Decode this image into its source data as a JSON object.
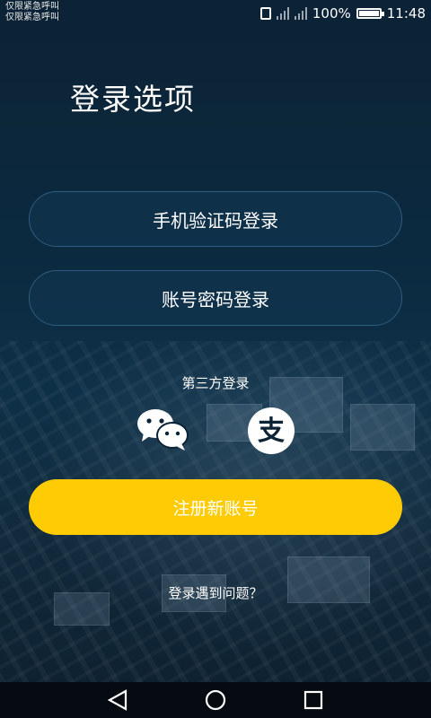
{
  "status": {
    "emergency_line1": "仅限紧急呼叫",
    "emergency_line2": "仅限紧急呼叫",
    "battery": "100%",
    "time": "11:48"
  },
  "page": {
    "title": "登录选项"
  },
  "login": {
    "phone_label": "手机验证码登录",
    "account_label": "账号密码登录",
    "third_party_label": "第三方登录"
  },
  "register": {
    "label": "注册新账号"
  },
  "help": {
    "label": "登录遇到问题？"
  },
  "colors": {
    "accent": "#fecb05",
    "background": "#0c2235"
  },
  "icons": [
    "wechat-icon",
    "alipay-icon",
    "back-icon",
    "home-icon",
    "recents-icon"
  ]
}
